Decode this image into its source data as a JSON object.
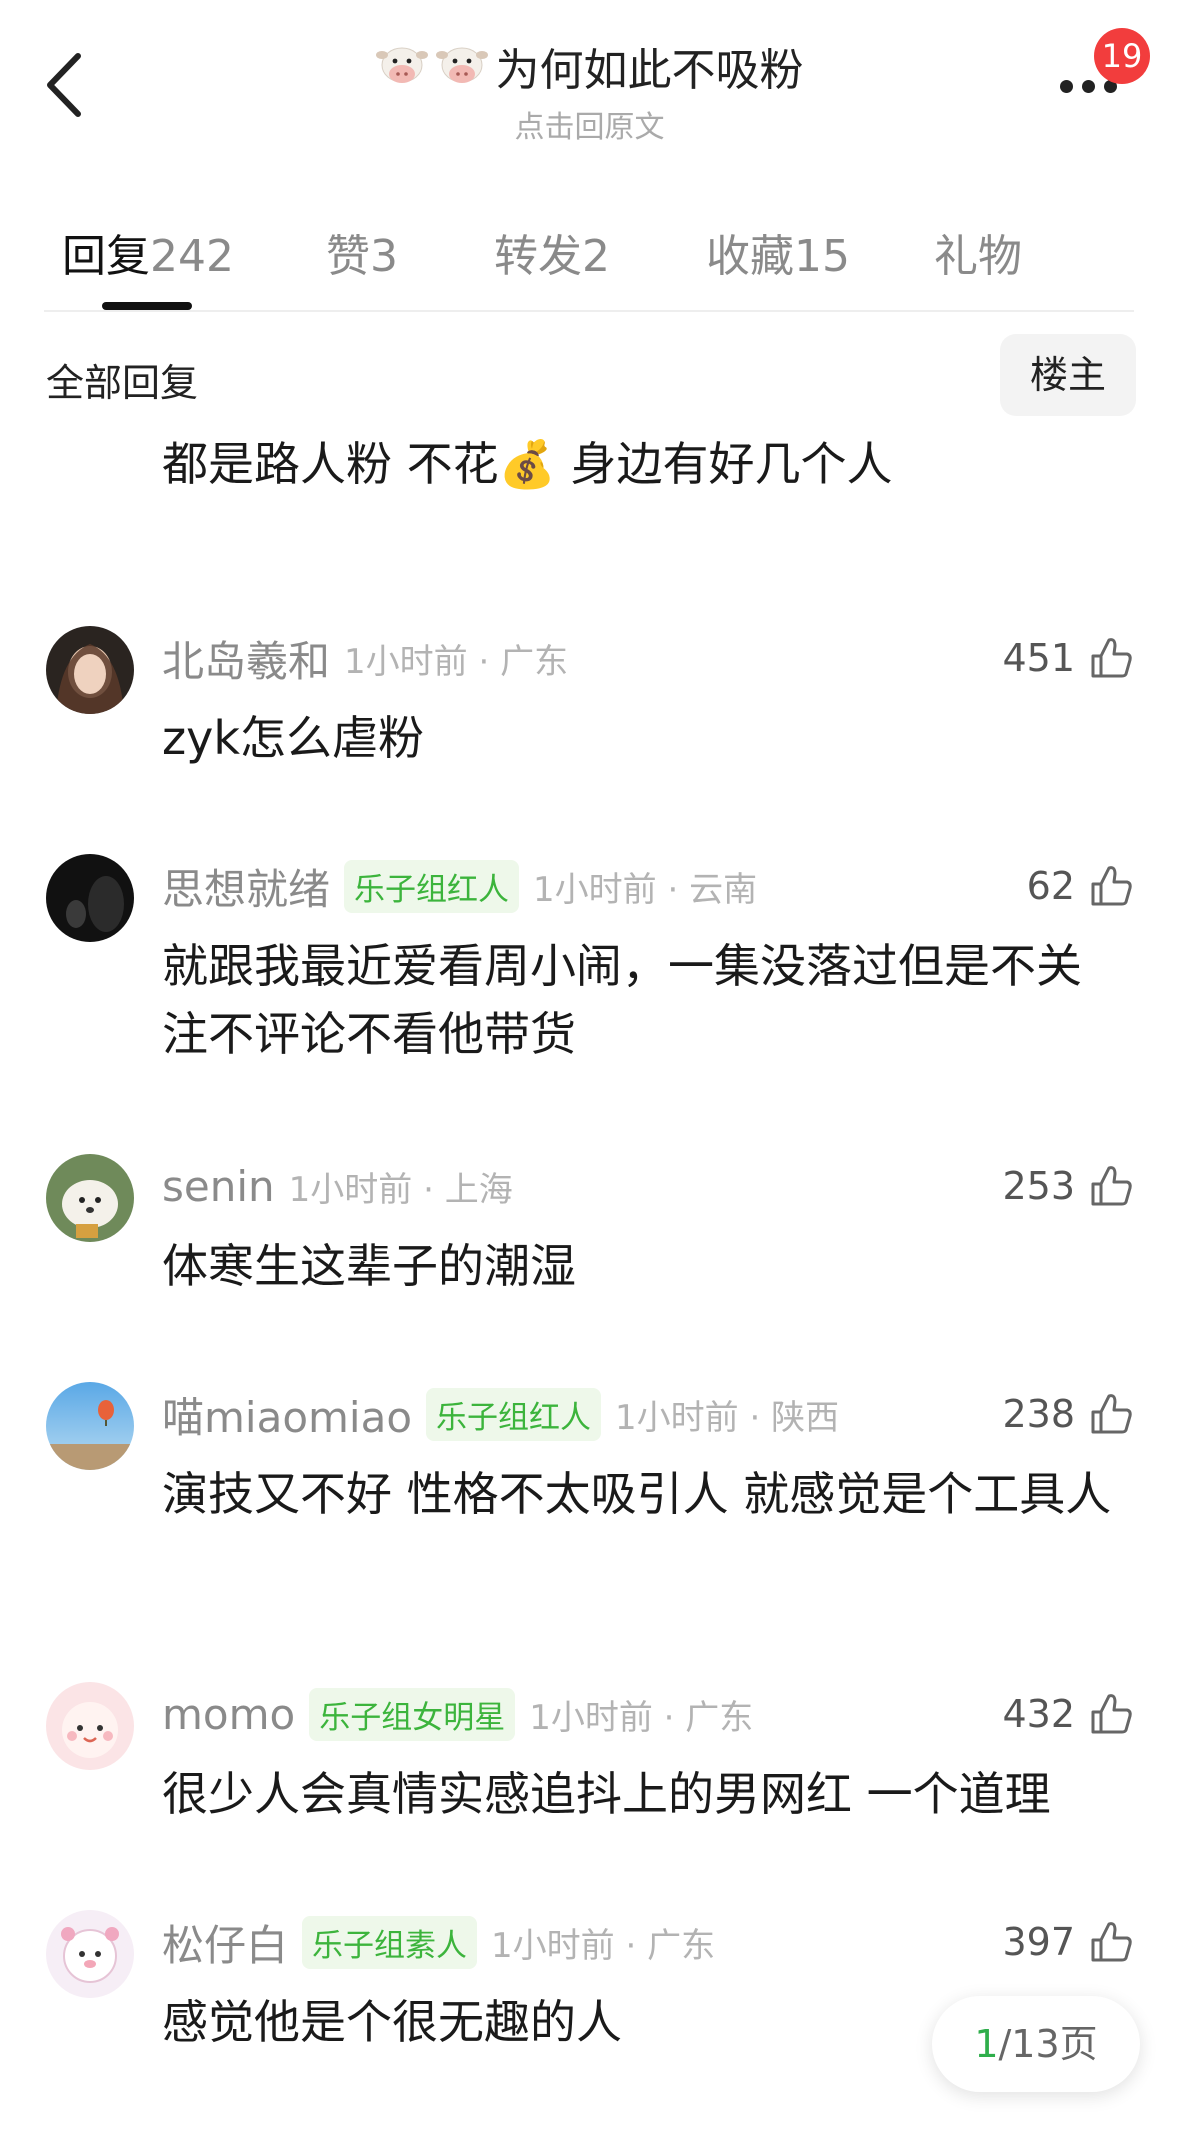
{
  "header": {
    "title_emoji": "🐮 🐮",
    "title": "为何如此不吸粉",
    "subtitle": "点击回原文",
    "badge_count": "19"
  },
  "tabs": [
    {
      "label": "回复",
      "count": "242",
      "active": true
    },
    {
      "label": "赞",
      "count": "3"
    },
    {
      "label": "转发",
      "count": "2"
    },
    {
      "label": "收藏",
      "count": "15"
    },
    {
      "label": "礼物",
      "count": ""
    }
  ],
  "filter": {
    "label": "全部回复",
    "owner_button": "楼主"
  },
  "comments": [
    {
      "user": "",
      "tag": "",
      "time": "",
      "likes": "",
      "text": "都是路人粉 不花💰 身边有好几个人"
    },
    {
      "user": "北岛羲和",
      "tag": "",
      "time": "1小时前 · 广东",
      "likes": "451",
      "text": "zyk怎么虐粉"
    },
    {
      "user": "思想就绪",
      "tag": "乐子组红人",
      "time": "1小时前 · 云南",
      "likes": "62",
      "text": "就跟我最近爱看周小闹，一集没落过但是不关注不评论不看他带货"
    },
    {
      "user": "senin",
      "tag": "",
      "time": "1小时前 · 上海",
      "likes": "253",
      "text": "体寒生这辈子的潮湿"
    },
    {
      "user": "喵miaomiao",
      "tag": "乐子组红人",
      "time": "1小时前 · 陕西",
      "likes": "238",
      "text": "演技又不好 性格不太吸引人 就感觉是个工具人"
    },
    {
      "user": "momo",
      "tag": "乐子组女明星",
      "time": "1小时前 · 广东",
      "likes": "432",
      "text": "很少人会真情实感追抖上的男网红 一个道理"
    },
    {
      "user": "松仔白",
      "tag": "乐子组素人",
      "time": "1小时前 · 广东",
      "likes": "397",
      "text": "感觉他是个很无趣的人"
    }
  ],
  "pager": {
    "current": "1",
    "total_text": "/13页"
  },
  "colors": {
    "accent_green": "#3cb43c",
    "badge_red": "#f23d3d"
  }
}
